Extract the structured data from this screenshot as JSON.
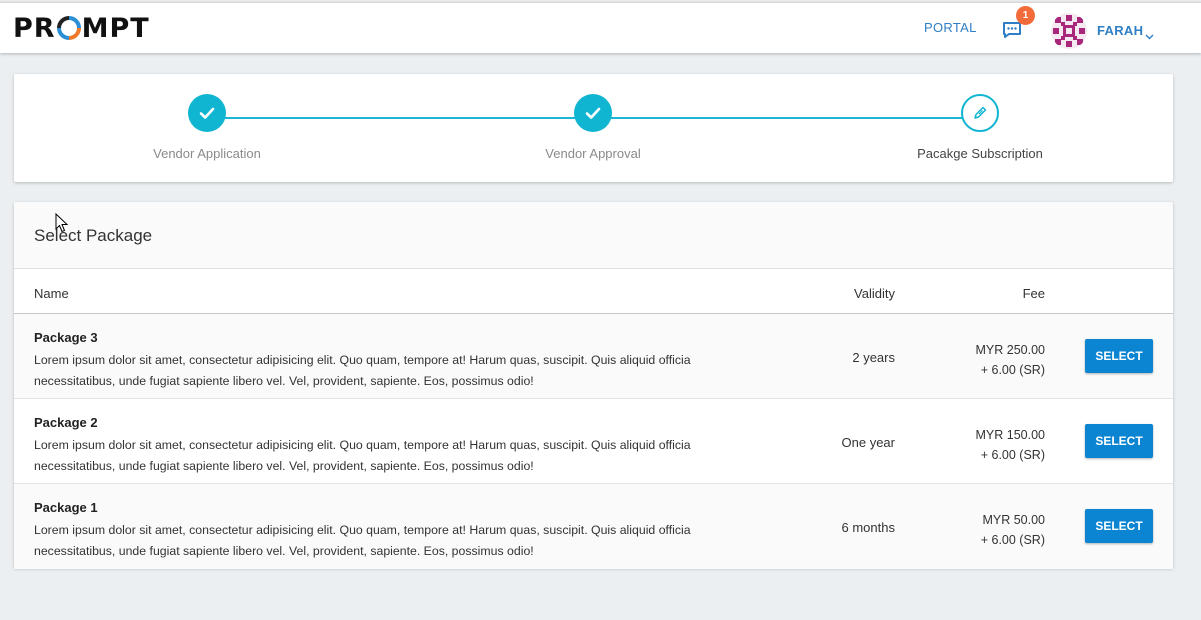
{
  "brand": {
    "logo_text_left": "PR",
    "logo_text_right": "MPT"
  },
  "nav": {
    "portal_label": "PORTAL",
    "chat_badge": "1",
    "user_name": "FARAH"
  },
  "stepper": {
    "steps": [
      {
        "label": "Vendor Application",
        "status": "done"
      },
      {
        "label": "Vendor Approval",
        "status": "done"
      },
      {
        "label": "Pacakge Subscription",
        "status": "active"
      }
    ],
    "accent_color": "#10b5d2"
  },
  "packages": {
    "title": "Select Package",
    "columns": {
      "name": "Name",
      "validity": "Validity",
      "fee": "Fee"
    },
    "rows": [
      {
        "name": "Package 3",
        "description": "Lorem ipsum dolor sit amet, consectetur adipisicing elit. Quo quam, tempore at! Harum quas, suscipit. Quis aliquid officia necessitatibus, unde fugiat sapiente libero vel. Vel, provident, sapiente. Eos, possimus odio!",
        "validity": "2 years",
        "fee": "MYR 250.00",
        "tax": "+ 6.00 (SR)",
        "button": "SELECT"
      },
      {
        "name": "Package 2",
        "description": "Lorem ipsum dolor sit amet, consectetur adipisicing elit. Quo quam, tempore at! Harum quas, suscipit. Quis aliquid officia necessitatibus, unde fugiat sapiente libero vel. Vel, provident, sapiente. Eos, possimus odio!",
        "validity": "One year",
        "fee": "MYR 150.00",
        "tax": "+ 6.00 (SR)",
        "button": "SELECT"
      },
      {
        "name": "Package 1",
        "description": "Lorem ipsum dolor sit amet, consectetur adipisicing elit. Quo quam, tempore at! Harum quas, suscipit. Quis aliquid officia necessitatibus, unde fugiat sapiente libero vel. Vel, provident, sapiente. Eos, possimus odio!",
        "validity": "6 months",
        "fee": "MYR 50.00",
        "tax": "+ 6.00 (SR)",
        "button": "SELECT"
      }
    ],
    "button_color": "#0b84d2"
  }
}
